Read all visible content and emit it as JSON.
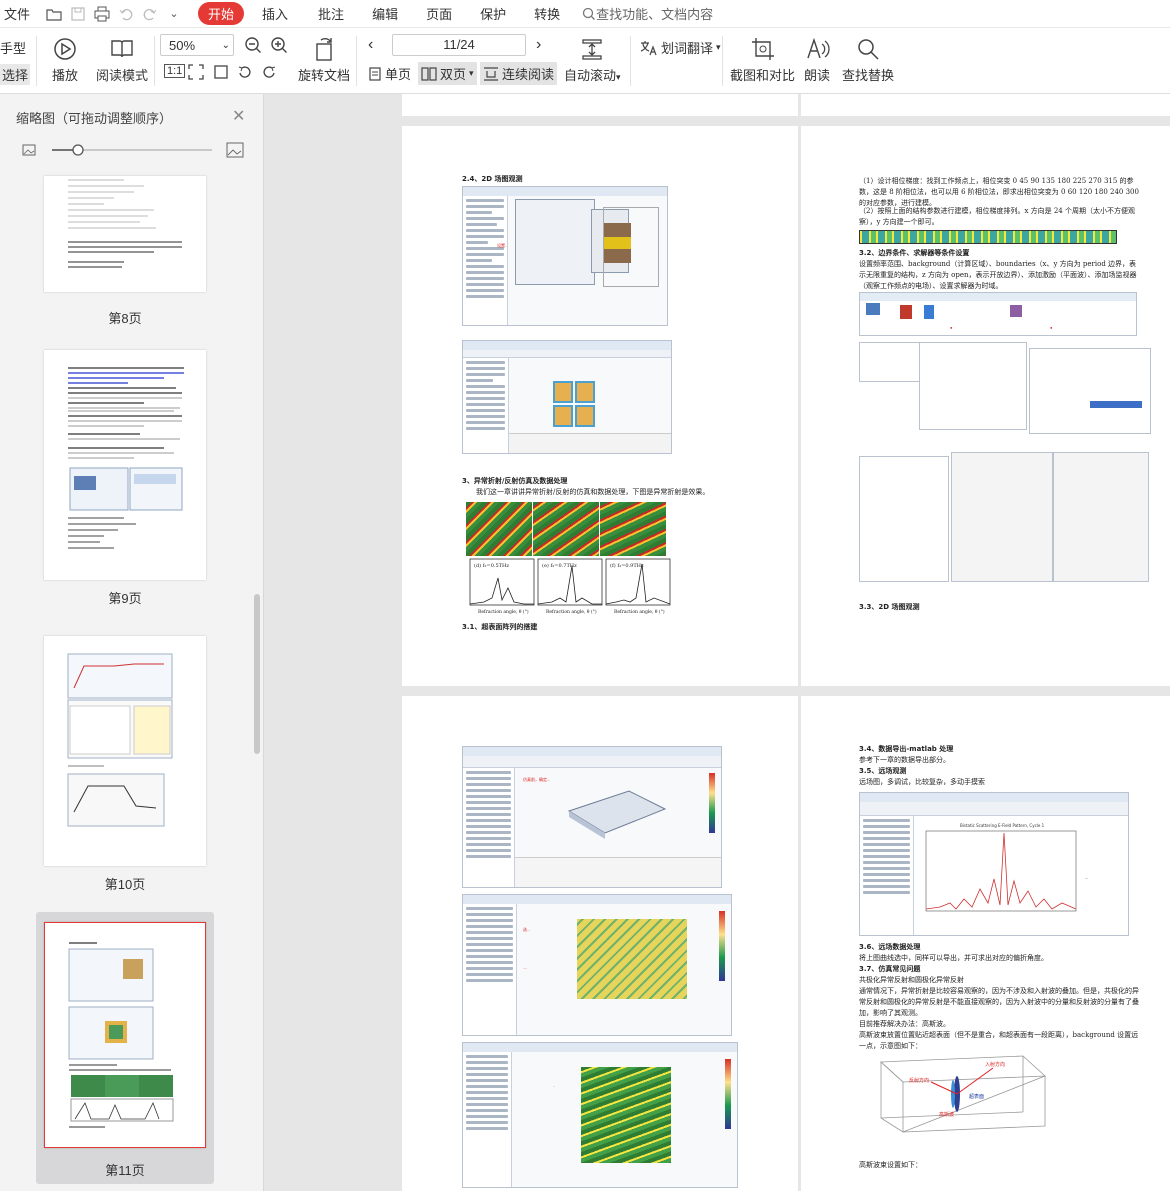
{
  "menubar": {
    "file": "文件",
    "tabs": [
      "开始",
      "插入",
      "批注",
      "编辑",
      "页面",
      "保护",
      "转换"
    ],
    "active_tab": "开始",
    "search_placeholder": "查找功能、文档内容"
  },
  "ribbon": {
    "hand": "手型",
    "select": "选择",
    "play": "播放",
    "read_mode": "阅读模式",
    "zoom": "50%",
    "rotate": "旋转文档",
    "page_indicator": "11/24",
    "single": "单页",
    "double": "双页",
    "continuous": "连续阅读",
    "autoscroll": "自动滚动",
    "translate": "划词翻译",
    "screenshot": "截图和对比",
    "read_aloud": "朗读",
    "find_replace": "查找替换"
  },
  "sidebar": {
    "title": "缩略图（可拖动调整顺序）",
    "thumbs": [
      "第8页",
      "第9页",
      "第10页",
      "第11页"
    ],
    "selected": "第11页"
  },
  "page_left_top": {
    "h1": "2.4、2D 场图观测",
    "h2": "3、异常折射/反射仿真及数据处理",
    "p1": "我们这一章讲讲异常折射/反射的仿真和数据处理，下图是异常折射是效果。",
    "plots": [
      "(d)  f₂=0.5THz",
      "(e)  f₂=0.7THz",
      "(f)  f₂=0.9THz"
    ],
    "plot_xlabel": "Refraction angle, θ (°)",
    "h3": "3.1、超表面阵列的搭建"
  },
  "page_right_top": {
    "p1": "（1）设计相位梯度：找到工作频点上，相位突变 0 45 90 135 180 225 270 315 的参数，这是 8 阶相位法，也可以用 6 阶相位法，即求出相位突变为 0 60 120 180 240 300 的对应参数，进行建模。",
    "p2": "（2）按照上面的结构参数进行建模，相位梯度排列。x 方向是 24 个周期（太小不方便观察），y 方向建一个即可。",
    "h1": "3.2、边界条件、求解器等条件设置",
    "p3": "设置频率范围、background（计算区域）、boundaries（x、y 方向为 period 边界，表示无限重复的结构，z 方向为 open，表示开放边界）、添加激励（平面波）、添加场监视器（观察工作频点的电场）、设置求解器为时域。",
    "h2": "3.3、2D 场图观测"
  },
  "page_right_bottom": {
    "h1": "3.4、数据导出-matlab 处理",
    "p1": "参考下一章的数据导出部分。",
    "h2": "3.5、远场观测",
    "p2": "远场图，多调试，比较复杂，多动手摸索",
    "chart_title": "Bistatic Scattering E-Field Pattern, Cycle 1",
    "h3": "3.6、远场数据处理",
    "p3": "将上图曲线选中，同样可以导出，并可求出对应的偏折角度。",
    "h4": "3.7、仿真常见问题",
    "p4": "共极化异常反射和圆极化异常反射",
    "p5": "通常情况下，异常折射是比较容易观察的，因为不涉及和入射波的叠加。但是，共极化的异常反射和圆极化的异常反射是不能直接观察的，因为入射波中的分量和反射波的分量有了叠加，影响了其观测。",
    "p6": "目前推荐解决办法：高斯波。",
    "p7": "高斯波束放置位置贴近超表面（但不是重合，和超表面有一段距离），background 设置远一点，示意图如下：",
    "diagram_labels": [
      "入射方向",
      "反射方向",
      "超表面",
      "高斯波"
    ],
    "p8": "高斯波束设置如下："
  },
  "colors": {
    "accent": "#e53935",
    "annotation_red": "#e02020"
  }
}
